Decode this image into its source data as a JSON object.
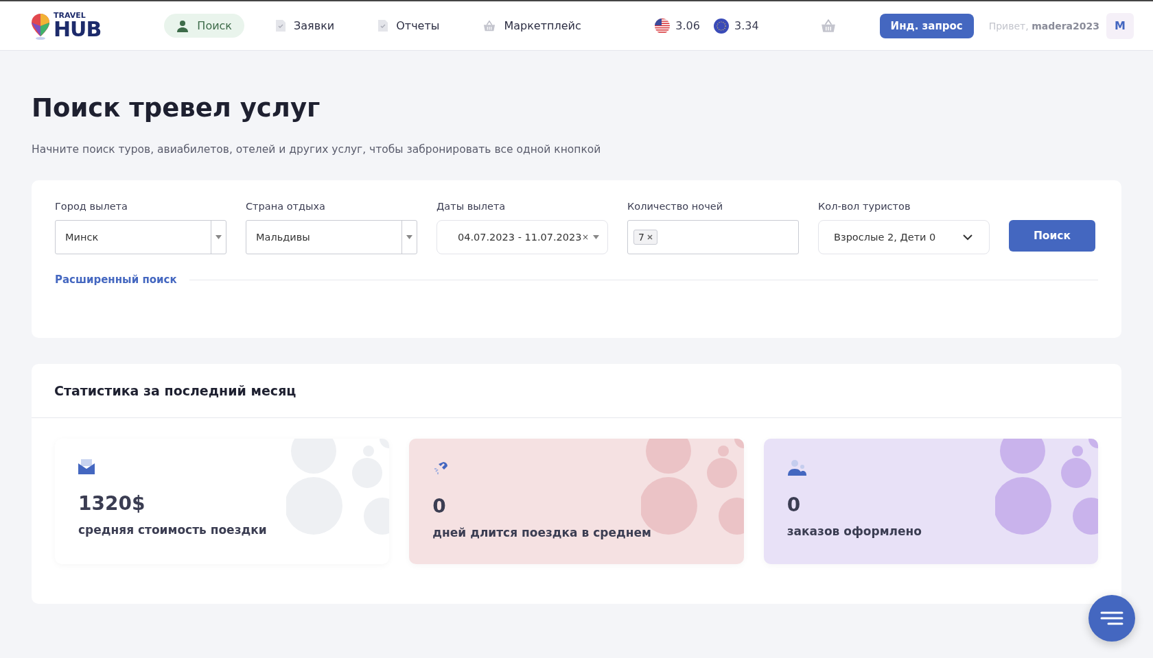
{
  "header": {
    "logo": {
      "top": "TRAVEL",
      "main": "HUB"
    },
    "nav": [
      {
        "label": "Поиск",
        "kind": "person",
        "selected": true
      },
      {
        "label": "Заявки",
        "kind": "doc",
        "selected": false
      },
      {
        "label": "Отчеты",
        "kind": "doc",
        "selected": false
      },
      {
        "label": "Маркетплейс",
        "kind": "basket",
        "selected": false
      }
    ],
    "rates": [
      {
        "kind": "usd",
        "value": "3.06"
      },
      {
        "kind": "eur",
        "value": "3.34"
      }
    ],
    "request_button": "Инд. запрос",
    "greeting": "Привет,",
    "username": "madera2023",
    "avatar": "M"
  },
  "page": {
    "title": "Поиск тревел услуг",
    "subtitle": "Начните поиск туров, авиабилетов, отелей и других услуг, чтобы забронировать все одной кнопкой"
  },
  "search": {
    "fields": [
      {
        "label": "Город вылета",
        "kind": "select",
        "value": "Минск"
      },
      {
        "label": "Страна отдыха",
        "kind": "select",
        "value": "Мальдивы"
      },
      {
        "label": "Даты вылета",
        "kind": "dates",
        "value": "04.07.2023 - 11.07.2023",
        "clear": "×"
      },
      {
        "label": "Количество ночей",
        "kind": "tags",
        "tags": [
          "7"
        ]
      },
      {
        "label": "Кол-вол туристов",
        "kind": "dropdown",
        "value": "Взрослые 2,  Дети 0"
      }
    ],
    "button": "Поиск",
    "advanced_link": "Расширенный поиск"
  },
  "stats": {
    "title": "Статистика за последний месяц",
    "cards": [
      {
        "kind": "mail",
        "value": "1320$",
        "label": "средняя стоимость поездки",
        "color": "#ffffff"
      },
      {
        "kind": "magnet",
        "value": "0",
        "label": "дней длится поездка в среднем",
        "color": "#f5e1e2"
      },
      {
        "kind": "people",
        "value": "0",
        "label": "заказов оформлено",
        "color": "#e8e1f7"
      }
    ]
  }
}
